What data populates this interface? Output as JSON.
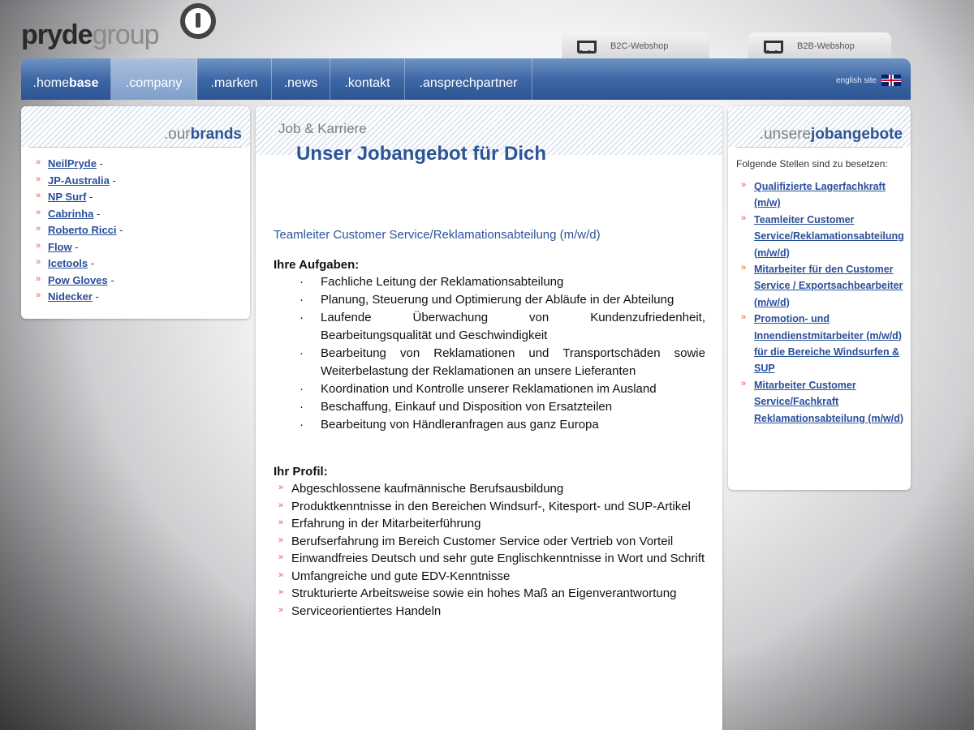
{
  "logo": {
    "pryde": "pryde",
    "group": "group"
  },
  "shops": [
    {
      "label": "B2C-Webshop"
    },
    {
      "label": "B2B-Webshop"
    }
  ],
  "nav": {
    "items": [
      {
        "prefix": ".home",
        "bold": "base"
      },
      {
        "prefix": ".company",
        "bold": ""
      },
      {
        "prefix": ".marken",
        "bold": ""
      },
      {
        "prefix": ".news",
        "bold": ""
      },
      {
        "prefix": ".kontakt",
        "bold": ""
      },
      {
        "prefix": ".ansprechpartner",
        "bold": ""
      }
    ],
    "english": "english site"
  },
  "brands_panel": {
    "title_prefix": ".our",
    "title_bold": "brands",
    "items": [
      {
        "name": "NeilPryde",
        "sep": " -"
      },
      {
        "name": "JP-Australia",
        "sep": " -"
      },
      {
        "name": "NP Surf",
        "sep": " -"
      },
      {
        "name": "Cabrinha",
        "sep": " -"
      },
      {
        "name": "Roberto Ricci",
        "sep": " -"
      },
      {
        "name": "Flow",
        "sep": " -"
      },
      {
        "name": "Icetools",
        "sep": " -"
      },
      {
        "name": "Pow Gloves",
        "sep": " -"
      },
      {
        "name": "Nidecker",
        "sep": " -"
      }
    ]
  },
  "main": {
    "crumb": "Job & Karriere",
    "title": "Unser Jobangebot für Dich",
    "job_title": "Teamleiter Customer Service/Reklamationsabteilung (m/w/d)",
    "tasks_heading": "Ihre Aufgaben:",
    "tasks": [
      "Fachliche Leitung der Reklamationsabteilung",
      "Planung, Steuerung und Optimierung der Abläufe in der Abteilung",
      "Laufende Überwachung von Kundenzufriedenheit, Bearbeitungsqualität und Geschwindigkeit",
      "Bearbeitung von Reklamationen und Transportschäden sowie Weiterbelastung der Reklamationen an unsere Lieferanten",
      "Koordination und Kontrolle unserer Reklamationen im Ausland",
      "Beschaffung, Einkauf und Disposition von Ersatzteilen",
      "Bearbeitung von Händleranfragen aus ganz Europa"
    ],
    "profile_heading": "Ihr Profil:",
    "profile": [
      "Abgeschlossene kaufmännische Berufsausbildung",
      "Produktkenntnisse in den Bereichen Windsurf-, Kitesport- und SUP-Artikel",
      "Erfahrung in der Mitarbeiterführung",
      "Berufserfahrung im Bereich Customer Service oder Vertrieb von Vorteil",
      "Einwandfreies Deutsch und sehr gute Englischkenntnisse in Wort und Schrift",
      "Umfangreiche und gute EDV-Kenntnisse",
      "Strukturierte Arbeitsweise sowie ein hohes Maß an Eigenverantwortung",
      "Serviceorientiertes Handeln"
    ]
  },
  "jobs_panel": {
    "title_prefix": ".unsere",
    "title_bold": "jobangebote",
    "intro": "Folgende Stellen sind zu besetzen:",
    "items": [
      "Qualifizierte Lagerfachkraft (m/w)",
      "Teamleiter Customer Service/Reklamationsabteilung (m/w/d)",
      "Mitarbeiter für den Customer Service / Exportsachbearbeiter (m/w/d)",
      "Promotion- und Innendienstmitarbeiter (m/w/d) für die Bereiche Windsurfen & SUP",
      "Mitarbeiter Customer Service/Fachkraft Reklamationsabteilung (m/w/d)"
    ]
  }
}
